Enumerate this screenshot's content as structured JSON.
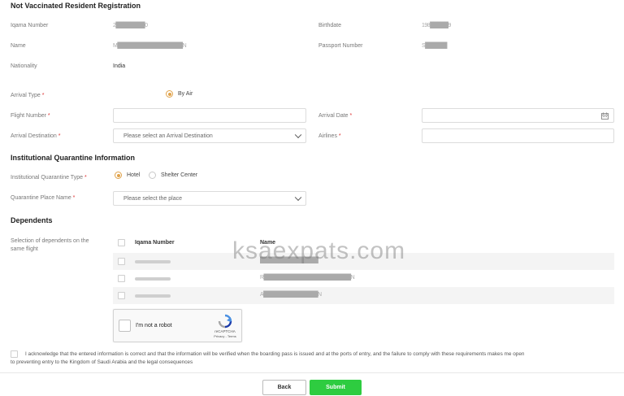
{
  "page": {
    "title": "Not Vaccinated Resident Registration"
  },
  "personal": {
    "iqama_label": "Iqama Number",
    "iqama_value": "2████████0",
    "birthdate_label": "Birthdate",
    "birthdate_value": "198█████9",
    "name_label": "Name",
    "name_value": "M██████████████████N",
    "passport_label": "Passport Number",
    "passport_value": "S██████",
    "nationality_label": "Nationality",
    "nationality_value": "India"
  },
  "travel": {
    "arrival_type_label": "Arrival Type",
    "arrival_type_option": "By Air",
    "flight_number_label": "Flight Number",
    "arrival_date_label": "Arrival Date",
    "arrival_destination_label": "Arrival Destination",
    "arrival_destination_placeholder": "Please select an Arrival Destination",
    "airlines_label": "Airlines",
    "required_mark": "*"
  },
  "quarantine": {
    "title": "Institutional Quarantine Information",
    "type_label": "Institutional Quarantine Type",
    "option_hotel": "Hotel",
    "option_shelter": "Shelter Center",
    "place_label": "Quarantine Place Name",
    "place_placeholder": "Please select the place"
  },
  "dependents": {
    "title": "Dependents",
    "selection_label_1": "Selection of dependents on the",
    "selection_label_2": "same flight",
    "col_iqama": "Iqama Number",
    "col_name": "Name",
    "rows": [
      {
        "name": "████████████████"
      },
      {
        "name": "R████████████████████████N"
      },
      {
        "name": "A███████████████N"
      }
    ]
  },
  "captcha": {
    "label": "I'm not a robot",
    "brand": "reCAPTCHA",
    "links": "Privacy - Terms"
  },
  "ack": {
    "line1": "I acknowledge that the entered information is correct and that the information will be verified when the boarding pass is issued and at the ports of entry, and the failure to comply with these requirements makes me open",
    "line2": "to preventing entry to the Kingdom of Saudi Arabia and the legal consequences"
  },
  "buttons": {
    "back": "Back",
    "submit": "Submit"
  },
  "watermark": "ksaexpats.com",
  "colors": {
    "accent": "#e0a24a",
    "submit": "#2ecc40"
  }
}
